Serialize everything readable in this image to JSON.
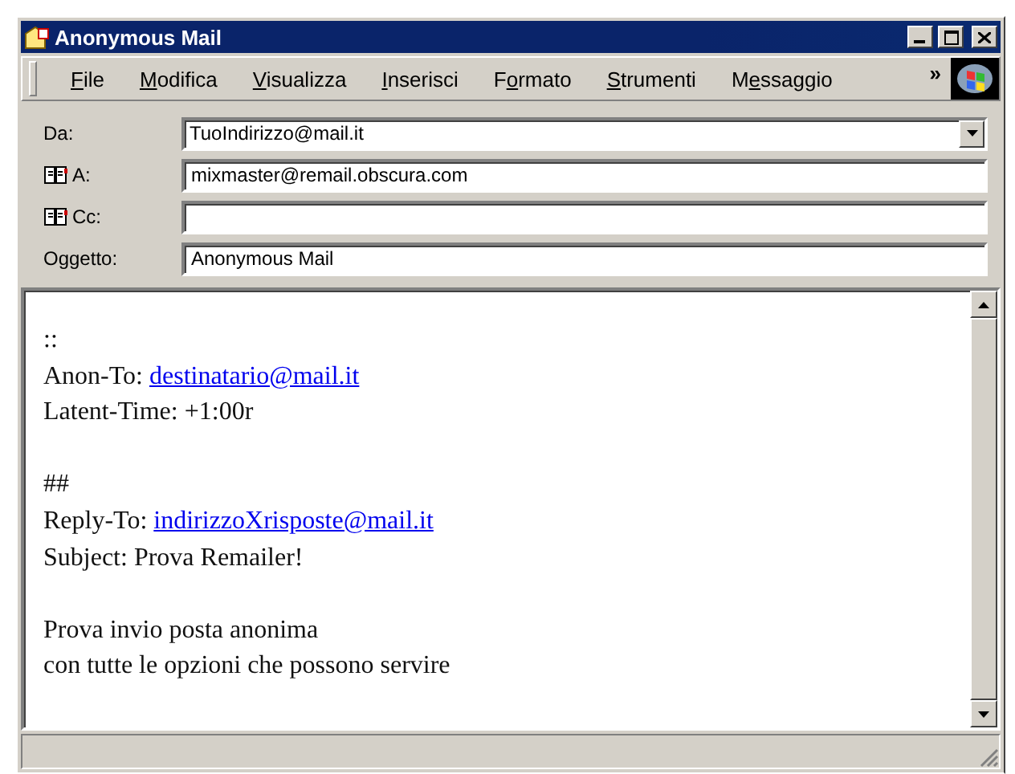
{
  "window": {
    "title": "Anonymous Mail"
  },
  "menu": [
    {
      "key": "F",
      "post": "ile"
    },
    {
      "key": "M",
      "post": "odifica"
    },
    {
      "key": "V",
      "post": "isualizza"
    },
    {
      "key": "I",
      "post": "nserisci"
    },
    {
      "pre": "F",
      "key": "o",
      "post": "rmato"
    },
    {
      "key": "S",
      "post": "trumenti"
    },
    {
      "pre": "M",
      "key": "e",
      "post": "ssaggio"
    }
  ],
  "menu_overflow": "»",
  "fields": [
    {
      "kind": "combo",
      "label": "Da:",
      "value": "TuoIndirizzo@mail.it",
      "address_book": false
    },
    {
      "kind": "text",
      "label": "A:",
      "value": "mixmaster@remail.obscura.com",
      "address_book": true
    },
    {
      "kind": "text",
      "label": "Cc:",
      "address_book": true
    },
    {
      "kind": "text",
      "label": "Oggetto:",
      "value": "Anonymous Mail",
      "address_book": false
    }
  ],
  "body": [
    {
      "kind": "text",
      "text": "::"
    },
    {
      "kind": "text",
      "text": "Anon-To: ",
      "link": "destinatario@mail.it"
    },
    {
      "kind": "text",
      "text": "Latent-Time: +1:00r"
    },
    {
      "kind": "blank"
    },
    {
      "kind": "text",
      "text": "##"
    },
    {
      "kind": "text",
      "text": "Reply-To: ",
      "link": "indirizzoXrisposte@mail.it"
    },
    {
      "kind": "text",
      "text": "Subject: Prova Remailer!"
    },
    {
      "kind": "blank"
    },
    {
      "kind": "text",
      "text": "Prova invio posta anonima"
    },
    {
      "kind": "text",
      "text": "con tutte le opzioni che possono servire"
    }
  ]
}
